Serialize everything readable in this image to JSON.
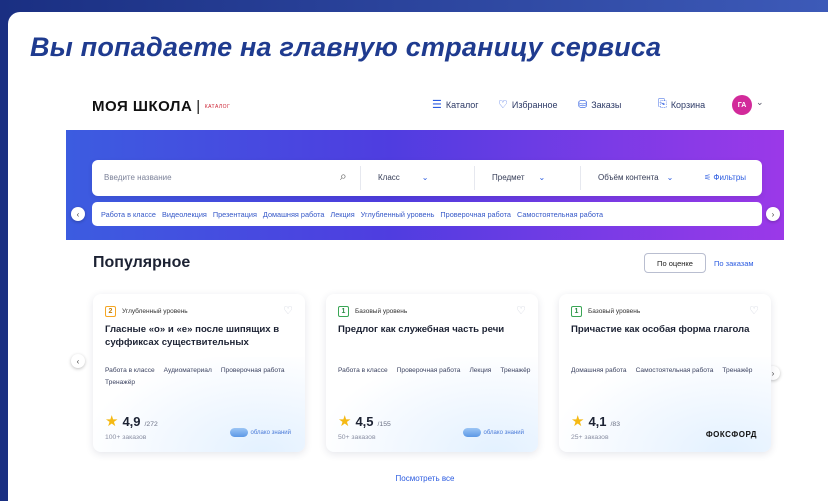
{
  "slide": {
    "headline": "Вы попадаете на главную страницу сервиса"
  },
  "header": {
    "logo": "МОЯ ШКОЛА",
    "logo_tag": "КАТАЛОГ",
    "nav": [
      {
        "icon": "list-icon",
        "label": "Каталог"
      },
      {
        "icon": "heart-icon",
        "label": "Избранное"
      },
      {
        "icon": "orders-icon",
        "label": "Заказы"
      },
      {
        "icon": "bag-icon",
        "label": "Корзина"
      }
    ],
    "avatar_initials": "ГА"
  },
  "search": {
    "placeholder": "Введите название",
    "class_label": "Класс",
    "subject_label": "Предмет",
    "volume_label": "Объём контента",
    "filters_label": "Фильтры"
  },
  "chips": [
    "Работа в классе",
    "Видеолекция",
    "Презентация",
    "Домашняя работа",
    "Лекция",
    "Углубленный уровень",
    "Проверочная работа",
    "Самостоятельная работа"
  ],
  "popular": {
    "title": "Популярное",
    "sort_by_rating": "По оценке",
    "sort_by_orders": "По заказам",
    "see_all": "Посмотреть все"
  },
  "cards": [
    {
      "level_num": "2",
      "level_label": "Углубленный уровень",
      "title": "Гласные «о» и «е» после шипящих в суффиксах существительных",
      "tags": [
        "Работа в классе",
        "Аудиоматериал",
        "Проверочная работа",
        "Тренажёр"
      ],
      "rating": "4,9",
      "rating_count": "/272",
      "orders": "100+ заказов",
      "brand": "облако знаний"
    },
    {
      "level_num": "1",
      "level_label": "Базовый уровень",
      "title": "Предлог как служебная часть речи",
      "tags": [
        "Работа в классе",
        "Проверочная работа",
        "Лекция",
        "Тренажёр"
      ],
      "rating": "4,5",
      "rating_count": "/155",
      "orders": "50+ заказов",
      "brand": "облако знаний"
    },
    {
      "level_num": "1",
      "level_label": "Базовый уровень",
      "title": "Причастие как особая форма глагола",
      "tags": [
        "Домашняя работа",
        "Самостоятельная работа",
        "Тренажёр"
      ],
      "rating": "4,1",
      "rating_count": "/83",
      "orders": "25+ заказов",
      "brand": "ФОКСФОРД"
    }
  ],
  "colors": {
    "headline": "#1f3b8f",
    "accent": "#2b5be0",
    "level_2": "#f5a623",
    "level_1": "#3aa655",
    "star": "#f5b914"
  }
}
